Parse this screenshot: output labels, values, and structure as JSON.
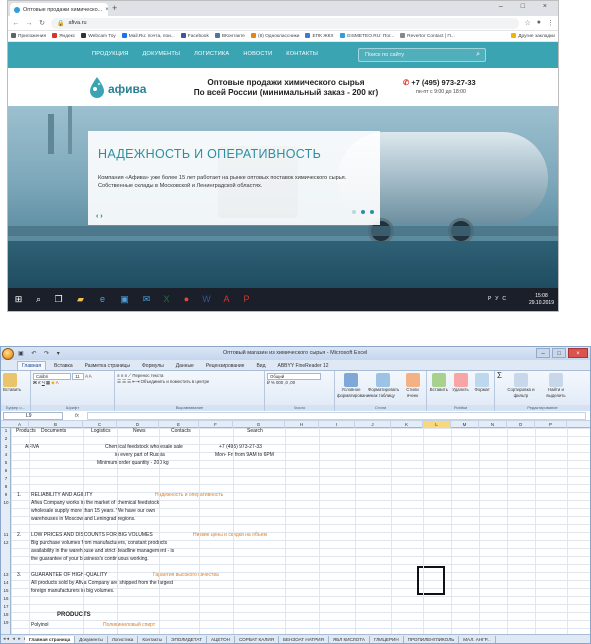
{
  "browser": {
    "tab_title": "Оптовые продажи химическо...",
    "tab_close": "×",
    "new_tab": "+",
    "window_controls": "– □ ×",
    "url": "afiva.ru",
    "bookmarks": [
      {
        "label": "Приложения",
        "color": "#5f6368"
      },
      {
        "label": "Яндекс",
        "color": "#d9342b"
      },
      {
        "label": "Webcam Toy",
        "color": "#333333"
      },
      {
        "label": "Mail.Ru: почта, пои...",
        "color": "#1a73e8"
      },
      {
        "label": "Facebook",
        "color": "#3b5998"
      },
      {
        "label": "ВКонтакте",
        "color": "#4a76a8"
      },
      {
        "label": "(8) Одноклассники",
        "color": "#ee8208"
      },
      {
        "label": "ЕПК ЖКХ",
        "color": "#3a7bd5"
      },
      {
        "label": "GISMETEO.RU: Пог...",
        "color": "#2e9fd8"
      },
      {
        "label": "Revertor Contact | П...",
        "color": "#888888"
      },
      {
        "label": "Другие закладки",
        "color": "#f2b400"
      }
    ]
  },
  "site": {
    "nav": [
      "ПРОДУКЦИЯ",
      "ДОКУМЕНТЫ",
      "ЛОГИСТИКА",
      "НОВОСТИ",
      "КОНТАКТЫ"
    ],
    "search_placeholder": "Поиск по сайту",
    "logo_name": "афива",
    "headline_line1": "Оптовые продажи химического сырья",
    "headline_line2": "По всей России (минимальный заказ - 200 кг)",
    "phone": "+7 (495) 973-27-33",
    "hours": "пн-пт с 9:00 до 18:00",
    "hero_title": "НАДЕЖНОСТЬ И ОПЕРАТИВНОСТЬ",
    "hero_text": "Компания «Афива» уже более 15 лет работает на рынке оптовых поставок химического сырья. Собственные склады в Московской и Ленинградской областях.",
    "hero_arrows": "‹ ›",
    "accent": "#3aa4b3"
  },
  "taskbar": {
    "time": "15:08",
    "date": "29.10.2019",
    "lang": "РУС"
  },
  "excel": {
    "caption": "Оптовый магазин из химического сырья - Microsoft Excel",
    "ribbon_tabs": [
      "Главная",
      "Вставка",
      "Разметка страницы",
      "Формулы",
      "Данные",
      "Рецензирование",
      "Вид",
      "ABBYY FineReader 12"
    ],
    "groups": {
      "clipboard": "Буфер о...",
      "clipboard_paste": "Вставить",
      "font": "Шрифт",
      "font_name": "Calibri",
      "font_size": "11",
      "alignment": "Выравнивание",
      "wrap": "Перенос текста",
      "merge": "Объединить и поместить в центре",
      "number": "Число",
      "number_format": "Общий",
      "styles": "Стили",
      "style_cond": "Условное форматирование",
      "style_table": "Форматировать как таблицу",
      "style_cells": "Стили ячеек",
      "cells": "Ячейки",
      "cells_insert": "Вставить",
      "cells_delete": "Удалить",
      "cells_format": "Формат",
      "editing": "Редактирование",
      "editing_sort": "Сортировка и фильтр",
      "editing_find": "Найти и выделить"
    },
    "name_box": "L9",
    "fx": "fx",
    "columns": [
      "A",
      "B",
      "C",
      "D",
      "E",
      "F",
      "G",
      "H",
      "I",
      "J",
      "K",
      "L",
      "M",
      "N",
      "O",
      "P"
    ],
    "rows": [
      "1",
      "2",
      "3",
      "4",
      "5",
      "6",
      "7",
      "8",
      "9",
      "10",
      "11",
      "12",
      "13",
      "14",
      "15",
      "16",
      "17",
      "18",
      "19"
    ],
    "cells": {
      "r1": [
        "Products",
        "Documents",
        "Logistics",
        "News",
        "Contacts",
        "Search"
      ],
      "afiva": "AFIVA",
      "tagline1": "Chemical feedstock wholesale sale",
      "tagline2": "in every part of Russia",
      "tagline3": "Minimum order quantity - 200 kg",
      "phone": "+7 (495) 973-27-33",
      "hours": "Mon- Fri from 9AM to 6PM",
      "n1": "1.",
      "h1": "RELIABILITY AND AGILITY",
      "h1_ru": "Надежность и оперативность",
      "t1a": "Afiva Company works in the market of chemical feedstock",
      "t1b": "wholesale supply more than 15 years. We have our own",
      "t1c": "warehouses in Moscow and Leningrad regions.",
      "n2": "2.",
      "h2": "LOW PRICES AND DISCOUNTS FOR BIG VOLUMES",
      "h2_ru": "Низкие цены и скидки на объем",
      "t2a": "Big purchase volumes from manufacturers, constant products",
      "t2b": "availability in the warehouse and strict deadline management - is",
      "t2c": "the guarantee of your business's continuous  working.",
      "n3": "3.",
      "h3": "GUARANTEE OF HIGH-QUALITY",
      "h3_ru": "Гарантия высокого качества",
      "t3a": "All products sold by Afiva Company are shipped from the largest",
      "t3b": "foreign manufacturers in big volumes.",
      "products": "PRODUCTS",
      "polyol": "Polyinol",
      "polyol_ru": "Поливиниловый спирт"
    },
    "sheet_tabs": [
      "Главная страница",
      "Документы",
      "Логистика",
      "Контакты",
      "ЭПОЛИДЕТАТ",
      "АЦЕТОН",
      "СОРБАТ КАЛИЯ",
      "БЕНЗОАТ НАТРИЯ",
      "ЯБЛ КИСЛОТА",
      "ГЛИЦЕРИН",
      "ПРОПИЛЕНГЛИКОЛЬ",
      "МАЛ. АНГР..."
    ]
  }
}
